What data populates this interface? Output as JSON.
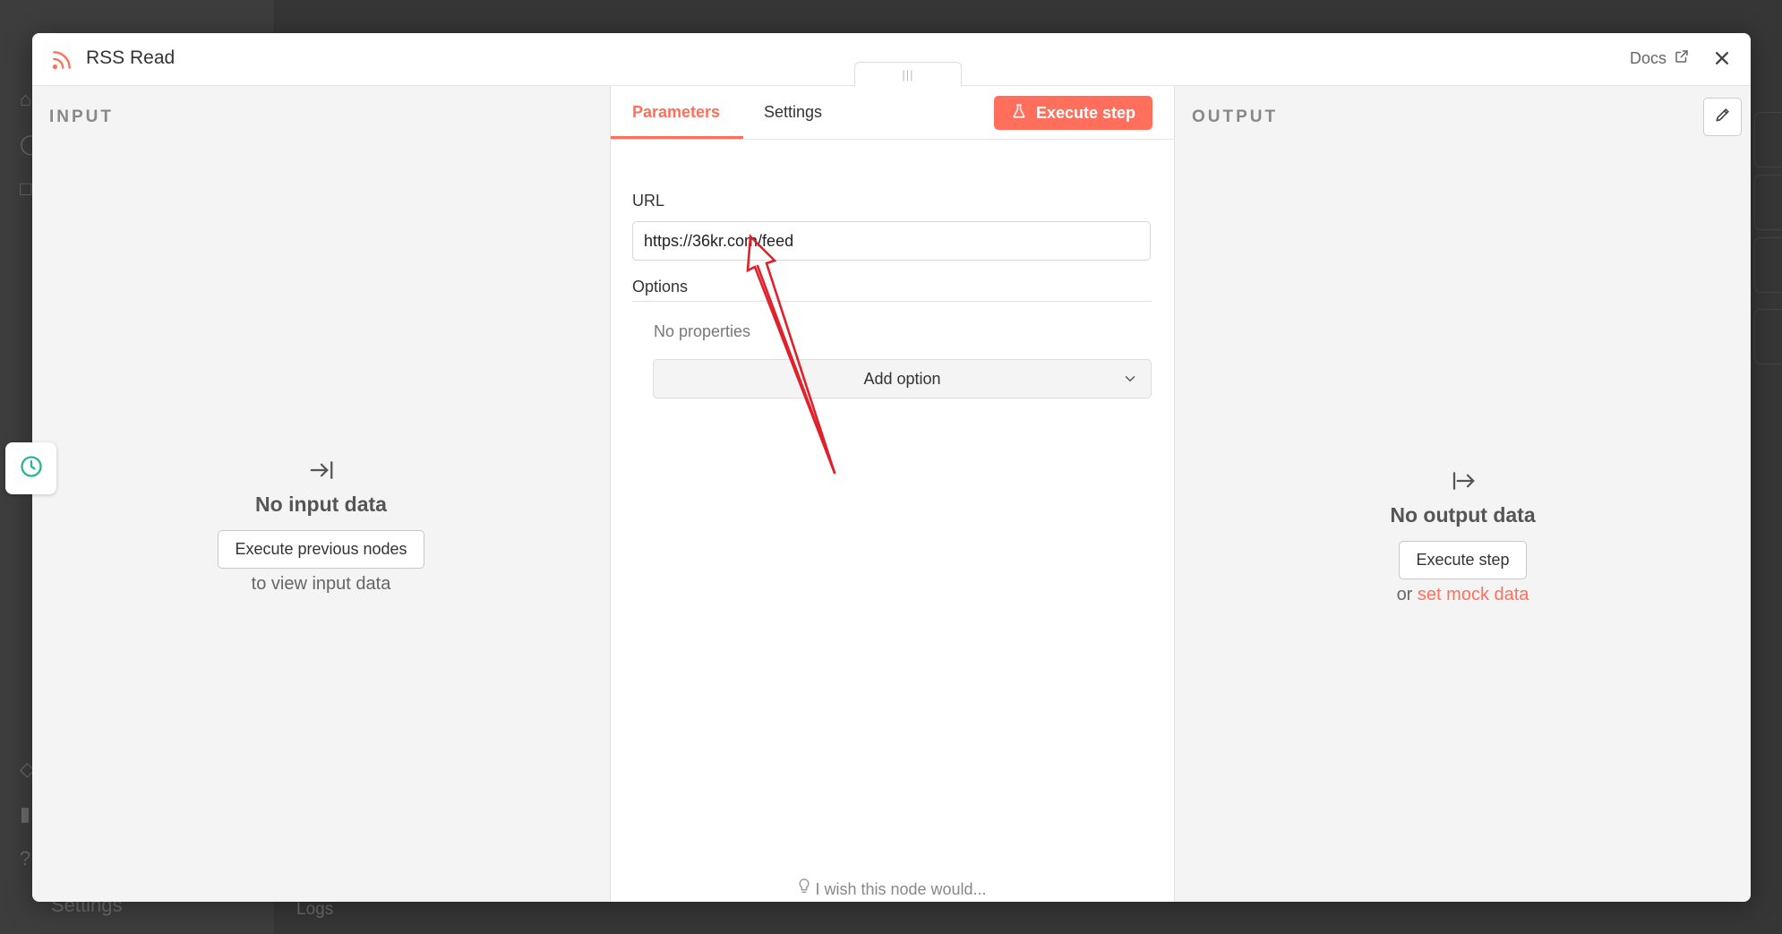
{
  "background": {
    "bottom_left_label": "Settings",
    "bottom_canvas_label": "Logs"
  },
  "modal": {
    "title": "RSS Read",
    "title_icon": "rss-icon",
    "docs_label": "Docs",
    "docs_icon": "external-link-icon",
    "close_icon": "close-icon",
    "drag_handle_icon": "grip-icon"
  },
  "input": {
    "label": "INPUT",
    "empty_icon": "arrow-to-right-bar-icon",
    "empty_title": "No input data",
    "button_label": "Execute previous nodes",
    "subtext": "to view input data"
  },
  "history_icon": "clock-icon",
  "parameters": {
    "tabs": [
      {
        "label": "Parameters",
        "active": true
      },
      {
        "label": "Settings",
        "active": false
      }
    ],
    "execute_label": "Execute step",
    "execute_icon": "flask-icon",
    "url_label": "URL",
    "url_value": "https://36kr.com/feed",
    "options_label": "Options",
    "no_properties": "No properties",
    "add_option_label": "Add option",
    "wish_label": "I wish this node would...",
    "wish_icon": "lightbulb-icon"
  },
  "output": {
    "label": "OUTPUT",
    "edit_icon": "pencil-icon",
    "empty_icon": "arrow-from-bar-right-icon",
    "empty_title": "No output data",
    "button_label": "Execute step",
    "subtext_prefix": "or",
    "subtext_link": "set mock data"
  },
  "colors": {
    "accent": "#ff6f5c",
    "annotation_arrow": "#e0202a",
    "history_icon": "#2bb39a"
  }
}
